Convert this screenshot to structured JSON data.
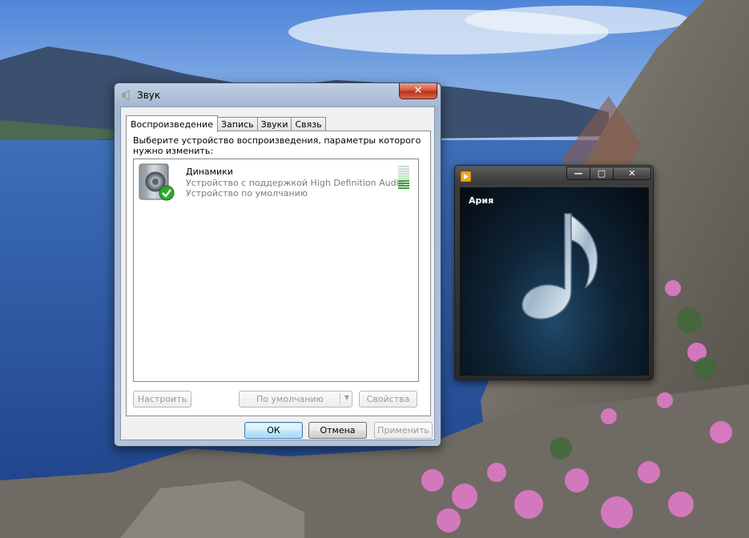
{
  "dialog": {
    "title": "Звук",
    "close_symbol": "✕",
    "tabs": [
      {
        "label": "Воспроизведение",
        "active": true
      },
      {
        "label": "Запись",
        "active": false
      },
      {
        "label": "Звуки",
        "active": false
      },
      {
        "label": "Связь",
        "active": false
      }
    ],
    "instruction": "Выберите устройство воспроизведения, параметры которого нужно изменить:",
    "devices": [
      {
        "name": "Динамики",
        "description": "Устройство с поддержкой High Definition Audio",
        "status": "Устройство по умолчанию",
        "icon": "speaker-icon",
        "default_badge_icon": "green-check-icon",
        "level_bars_total": 10,
        "level_bars_active": 4
      }
    ],
    "buttons": {
      "configure": "Настроить",
      "set_default": "По умолчанию",
      "properties": "Свойства",
      "ok": "ОК",
      "cancel": "Отмена",
      "apply": "Применить"
    }
  },
  "media_player": {
    "track_title": "Ария",
    "controls": {
      "minimize": "—",
      "maximize": "□",
      "close": "✕"
    },
    "icon": "media-player-icon",
    "art_icon": "music-note-icon"
  },
  "colors": {
    "level_active": "#3aa03a",
    "level_inactive": "#c7dccb",
    "check_green": "#2fa82f"
  }
}
